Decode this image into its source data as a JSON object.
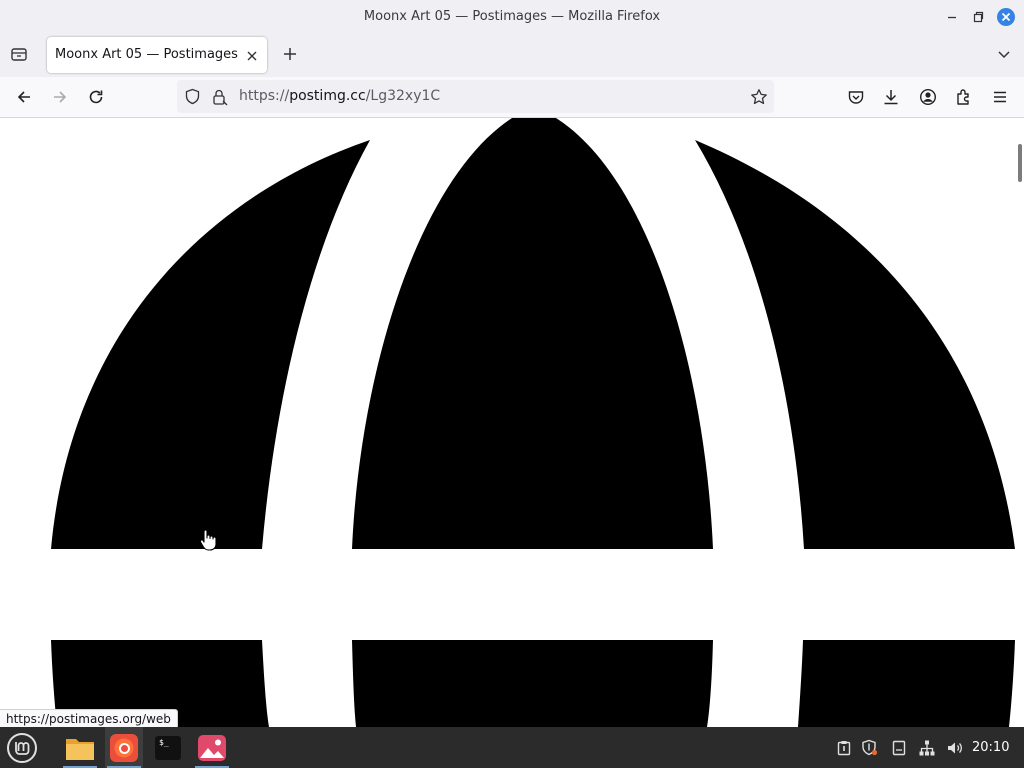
{
  "window": {
    "title": "Moonx Art 05 — Postimages — Mozilla Firefox",
    "controls": [
      "minimize-icon",
      "maximize-icon",
      "close-icon"
    ]
  },
  "tabs": [
    {
      "title": "Moonx Art 05 — Postimages",
      "active": true
    }
  ],
  "toolbar": {
    "url_scheme": "https://",
    "url_host": "postimg.cc",
    "url_path": "/Lg32xy1C",
    "left_icons": [
      "back-arrow-icon",
      "forward-arrow-icon",
      "reload-icon"
    ],
    "right_icons": [
      "pocket-icon",
      "downloads-icon",
      "account-icon",
      "extensions-icon",
      "menu-icon"
    ]
  },
  "page": {
    "status_url": "https://postimages.org/web",
    "image_colors": {
      "foreground": "#000000",
      "background": "#ffffff"
    }
  },
  "taskbar": {
    "apps": [
      "mint-menu-icon",
      "files-icon",
      "firefox-icon",
      "terminal-icon",
      "image-viewer-icon"
    ],
    "tray": [
      "clipboard-icon",
      "shield-icon",
      "notes-icon",
      "network-icon",
      "volume-icon"
    ],
    "clock": "20:10"
  },
  "colors": {
    "accent": "#0a84ff",
    "close_button": "#3584e4",
    "taskbar_indicator": "#75a3d1",
    "firefox_orange": "#ff7139"
  }
}
